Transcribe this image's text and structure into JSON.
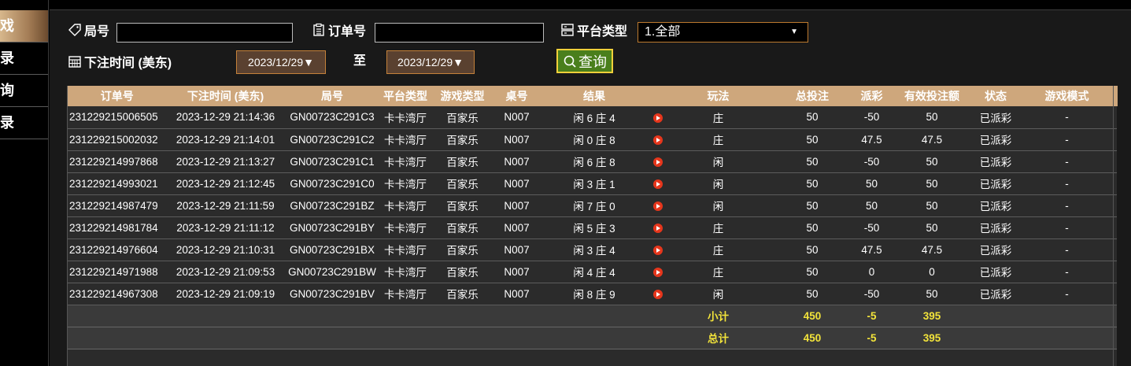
{
  "sidebar": {
    "items": [
      {
        "label": "戏",
        "active": true
      },
      {
        "label": "录",
        "active": false
      },
      {
        "label": "询",
        "active": false
      },
      {
        "label": "录",
        "active": false
      }
    ]
  },
  "filters": {
    "round_label": "局号",
    "round_value": "",
    "order_label": "订单号",
    "order_value": "",
    "platform_label": "平台类型",
    "platform_selected": "1.全部",
    "time_label": "下注时间 (美东)",
    "date_from": "2023/12/29▼",
    "to_label": "至",
    "date_to": "2023/12/29▼",
    "query_label": "查询"
  },
  "table": {
    "columns": [
      "订单号",
      "下注时间 (美东)",
      "局号",
      "平台类型",
      "游戏类型",
      "桌号",
      "结果",
      "",
      "玩法",
      "总投注",
      "派彩",
      "有效投注额",
      "状态",
      "游戏模式"
    ],
    "rows": [
      {
        "order": "231229215006505",
        "time": "2023-12-29 21:14:36",
        "round": "GN00723C291C3",
        "platform": "卡卡湾厅",
        "game": "百家乐",
        "table": "N007",
        "result": "闲 6 庄 4",
        "play": "庄",
        "bet": "50",
        "payout": "-50",
        "payout_type": "win",
        "valid": "50",
        "status": "已派彩",
        "mode": "-"
      },
      {
        "order": "231229215002032",
        "time": "2023-12-29 21:14:01",
        "round": "GN00723C291C2",
        "platform": "卡卡湾厅",
        "game": "百家乐",
        "table": "N007",
        "result": "闲 0 庄 8",
        "play": "庄",
        "bet": "50",
        "payout": "47.5",
        "payout_type": "lose",
        "valid": "47.5",
        "status": "已派彩",
        "mode": "-"
      },
      {
        "order": "231229214997868",
        "time": "2023-12-29 21:13:27",
        "round": "GN00723C291C1",
        "platform": "卡卡湾厅",
        "game": "百家乐",
        "table": "N007",
        "result": "闲 6 庄 8",
        "play": "闲",
        "bet": "50",
        "payout": "-50",
        "payout_type": "win",
        "valid": "50",
        "status": "已派彩",
        "mode": "-"
      },
      {
        "order": "231229214993021",
        "time": "2023-12-29 21:12:45",
        "round": "GN00723C291C0",
        "platform": "卡卡湾厅",
        "game": "百家乐",
        "table": "N007",
        "result": "闲 3 庄 1",
        "play": "闲",
        "bet": "50",
        "payout": "50",
        "payout_type": "lose",
        "valid": "50",
        "status": "已派彩",
        "mode": "-"
      },
      {
        "order": "231229214987479",
        "time": "2023-12-29 21:11:59",
        "round": "GN00723C291BZ",
        "platform": "卡卡湾厅",
        "game": "百家乐",
        "table": "N007",
        "result": "闲 7 庄 0",
        "play": "闲",
        "bet": "50",
        "payout": "50",
        "payout_type": "lose",
        "valid": "50",
        "status": "已派彩",
        "mode": "-"
      },
      {
        "order": "231229214981784",
        "time": "2023-12-29 21:11:12",
        "round": "GN00723C291BY",
        "platform": "卡卡湾厅",
        "game": "百家乐",
        "table": "N007",
        "result": "闲 5 庄 3",
        "play": "庄",
        "bet": "50",
        "payout": "-50",
        "payout_type": "win",
        "valid": "50",
        "status": "已派彩",
        "mode": "-"
      },
      {
        "order": "231229214976604",
        "time": "2023-12-29 21:10:31",
        "round": "GN00723C291BX",
        "platform": "卡卡湾厅",
        "game": "百家乐",
        "table": "N007",
        "result": "闲 3 庄 4",
        "play": "庄",
        "bet": "50",
        "payout": "47.5",
        "payout_type": "lose",
        "valid": "47.5",
        "status": "已派彩",
        "mode": "-"
      },
      {
        "order": "231229214971988",
        "time": "2023-12-29 21:09:53",
        "round": "GN00723C291BW",
        "platform": "卡卡湾厅",
        "game": "百家乐",
        "table": "N007",
        "result": "闲 4 庄 4",
        "play": "庄",
        "bet": "50",
        "payout": "0",
        "payout_type": "neutral",
        "valid": "0",
        "status": "已派彩",
        "mode": "-"
      },
      {
        "order": "231229214967308",
        "time": "2023-12-29 21:09:19",
        "round": "GN00723C291BV",
        "platform": "卡卡湾厅",
        "game": "百家乐",
        "table": "N007",
        "result": "闲 8 庄 9",
        "play": "闲",
        "bet": "50",
        "payout": "-50",
        "payout_type": "win",
        "valid": "50",
        "status": "已派彩",
        "mode": "-"
      }
    ],
    "subtotal": {
      "label": "小计",
      "bet": "450",
      "payout": "-5",
      "valid": "395"
    },
    "total": {
      "label": "总计",
      "bet": "450",
      "payout": "-5",
      "valid": "395"
    }
  },
  "colors": {
    "header_bg": "#cea77c",
    "accent_border": "#c4813a",
    "win_text": "#56d12d",
    "lose_text": "#b3202a",
    "sum_text": "#f2e33a"
  }
}
